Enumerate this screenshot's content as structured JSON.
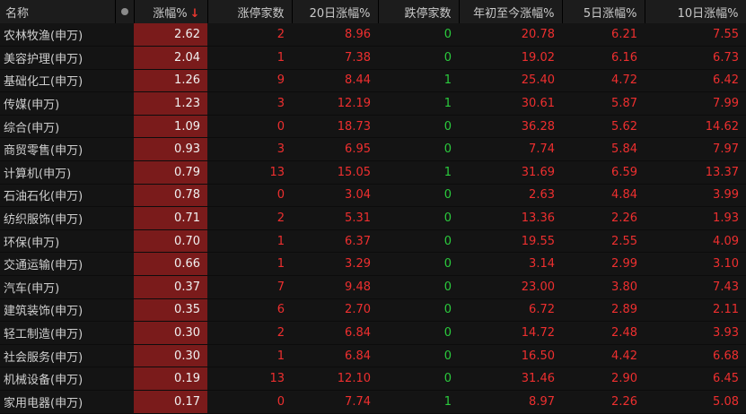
{
  "header": {
    "name": "名称",
    "change_pct": "涨幅%",
    "sort_indicator": "↓",
    "limit_up_count": "涨停家数",
    "change_20d": "20日涨幅%",
    "limit_down_count": "跌停家数",
    "ytd_change": "年初至今涨幅%",
    "change_5d": "5日涨幅%",
    "change_10d": "10日涨幅%"
  },
  "colors": {
    "up": "#ee2f2f",
    "down": "#2bcb3d",
    "highlight": "#7a1b1b",
    "background": "#141414"
  },
  "rows": [
    {
      "name": "农林牧渔(申万)",
      "change": "2.62",
      "up": "2",
      "d20": "8.96",
      "down": "0",
      "ytd": "20.78",
      "d5": "6.21",
      "d10": "7.55"
    },
    {
      "name": "美容护理(申万)",
      "change": "2.04",
      "up": "1",
      "d20": "7.38",
      "down": "0",
      "ytd": "19.02",
      "d5": "6.16",
      "d10": "6.73"
    },
    {
      "name": "基础化工(申万)",
      "change": "1.26",
      "up": "9",
      "d20": "8.44",
      "down": "1",
      "ytd": "25.40",
      "d5": "4.72",
      "d10": "6.42"
    },
    {
      "name": "传媒(申万)",
      "change": "1.23",
      "up": "3",
      "d20": "12.19",
      "down": "1",
      "ytd": "30.61",
      "d5": "5.87",
      "d10": "7.99"
    },
    {
      "name": "综合(申万)",
      "change": "1.09",
      "up": "0",
      "d20": "18.73",
      "down": "0",
      "ytd": "36.28",
      "d5": "5.62",
      "d10": "14.62"
    },
    {
      "name": "商贸零售(申万)",
      "change": "0.93",
      "up": "3",
      "d20": "6.95",
      "down": "0",
      "ytd": "7.74",
      "d5": "5.84",
      "d10": "7.97"
    },
    {
      "name": "计算机(申万)",
      "change": "0.79",
      "up": "13",
      "d20": "15.05",
      "down": "1",
      "ytd": "31.69",
      "d5": "6.59",
      "d10": "13.37"
    },
    {
      "name": "石油石化(申万)",
      "change": "0.78",
      "up": "0",
      "d20": "3.04",
      "down": "0",
      "ytd": "2.63",
      "d5": "4.84",
      "d10": "3.99"
    },
    {
      "name": "纺织服饰(申万)",
      "change": "0.71",
      "up": "2",
      "d20": "5.31",
      "down": "0",
      "ytd": "13.36",
      "d5": "2.26",
      "d10": "1.93"
    },
    {
      "name": "环保(申万)",
      "change": "0.70",
      "up": "1",
      "d20": "6.37",
      "down": "0",
      "ytd": "19.55",
      "d5": "2.55",
      "d10": "4.09"
    },
    {
      "name": "交通运输(申万)",
      "change": "0.66",
      "up": "1",
      "d20": "3.29",
      "down": "0",
      "ytd": "3.14",
      "d5": "2.99",
      "d10": "3.10"
    },
    {
      "name": "汽车(申万)",
      "change": "0.37",
      "up": "7",
      "d20": "9.48",
      "down": "0",
      "ytd": "23.00",
      "d5": "3.80",
      "d10": "7.43"
    },
    {
      "name": "建筑装饰(申万)",
      "change": "0.35",
      "up": "6",
      "d20": "2.70",
      "down": "0",
      "ytd": "6.72",
      "d5": "2.89",
      "d10": "2.11"
    },
    {
      "name": "轻工制造(申万)",
      "change": "0.30",
      "up": "2",
      "d20": "6.84",
      "down": "0",
      "ytd": "14.72",
      "d5": "2.48",
      "d10": "3.93"
    },
    {
      "name": "社会服务(申万)",
      "change": "0.30",
      "up": "1",
      "d20": "6.84",
      "down": "0",
      "ytd": "16.50",
      "d5": "4.42",
      "d10": "6.68"
    },
    {
      "name": "机械设备(申万)",
      "change": "0.19",
      "up": "13",
      "d20": "12.10",
      "down": "0",
      "ytd": "31.46",
      "d5": "2.90",
      "d10": "6.45"
    },
    {
      "name": "家用电器(申万)",
      "change": "0.17",
      "up": "0",
      "d20": "7.74",
      "down": "1",
      "ytd": "8.97",
      "d5": "2.26",
      "d10": "5.08"
    }
  ]
}
